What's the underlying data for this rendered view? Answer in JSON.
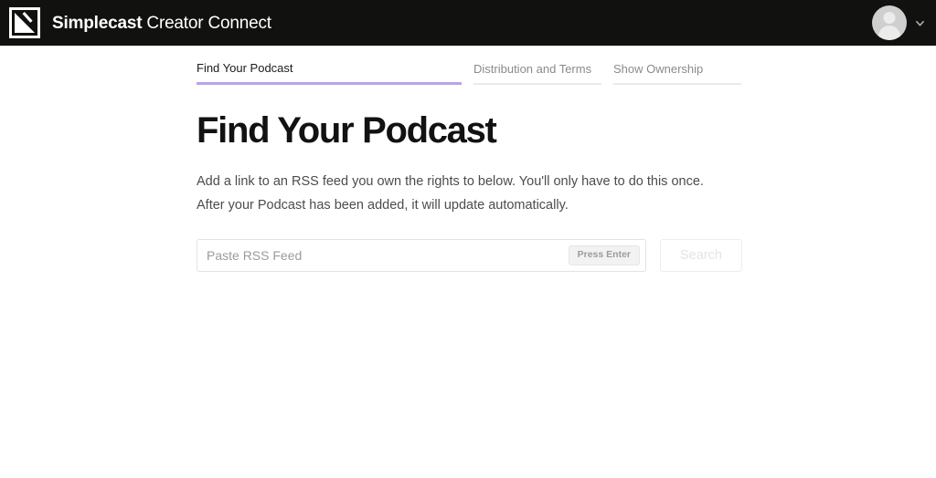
{
  "header": {
    "logo_icon": "simplecast-logo-icon",
    "brand_bold": "Simplecast",
    "brand_light": "Creator Connect",
    "account": {
      "avatar_icon": "user-avatar-icon",
      "chevron_icon": "chevron-down-icon"
    },
    "background_color": "#11120f"
  },
  "tabs": [
    {
      "label": "Find Your Podcast",
      "active": true,
      "underline_color": "#b9a3ea"
    },
    {
      "label": "Distribution and Terms",
      "active": false,
      "underline_color": "#eaeaea"
    },
    {
      "label": "Show Ownership",
      "active": false,
      "underline_color": "#eaeaea"
    }
  ],
  "main": {
    "title": "Find Your Podcast",
    "description": "Add a link to an RSS feed you own the rights to below. You'll only have to do this once. After your Podcast has been added, it will update automatically.",
    "feed_input": {
      "value": "",
      "placeholder": "Paste RSS Feed",
      "hint_badge": "Press Enter"
    },
    "search_button": {
      "label": "Search",
      "disabled": true
    }
  }
}
